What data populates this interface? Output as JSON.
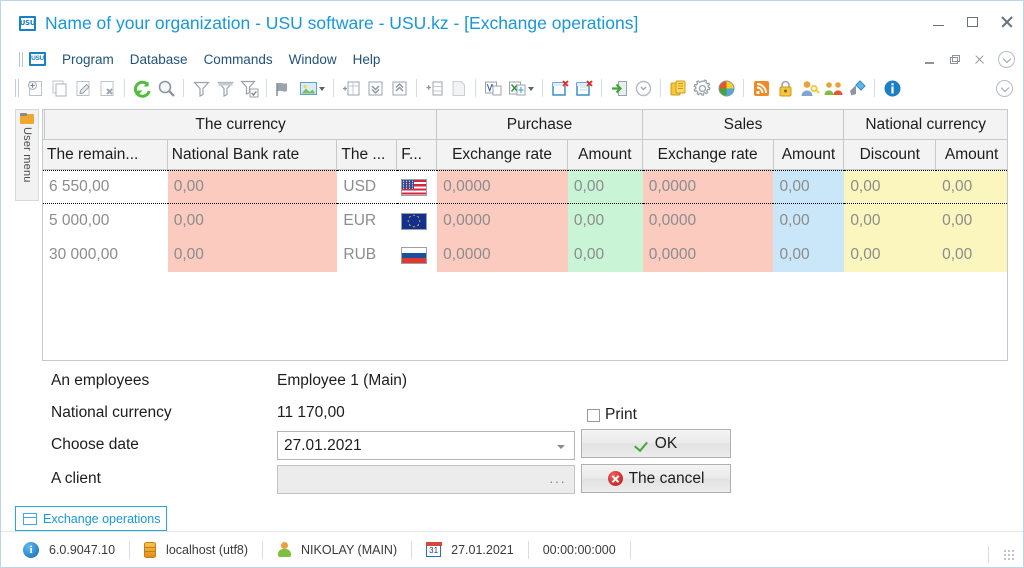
{
  "window": {
    "title": "Name of your organization - USU software - USU.kz - [Exchange operations]",
    "app_icon": "usu",
    "minimize": "–",
    "maximize": "□",
    "close": "×"
  },
  "menubar": {
    "icon": "usu",
    "items": [
      {
        "label": "Program"
      },
      {
        "label": "Database"
      },
      {
        "label": "Commands"
      },
      {
        "label": "Window"
      },
      {
        "label": "Help"
      }
    ]
  },
  "toolbar": {
    "groups": [
      {
        "icons": [
          "add-record-icon",
          "copy-record-icon",
          "edit-record-icon",
          "delete-record-icon"
        ]
      },
      {
        "icons": [
          "refresh-icon",
          "search-icon"
        ]
      },
      {
        "icons": [
          "filter-icon",
          "filter-advanced-icon",
          "filter-apply-icon"
        ]
      },
      {
        "icons": [
          "bookmark-icon",
          "image-view-icon"
        ]
      },
      {
        "icons": [
          "group-columns-icon",
          "expand-all-icon",
          "collapse-all-icon"
        ]
      },
      {
        "icons": [
          "add-column-icon",
          "blank-page-icon"
        ]
      },
      {
        "icons": [
          "export-word-icon",
          "export-excel-icon"
        ]
      },
      {
        "icons": [
          "close-window-icon",
          "close-all-windows-icon"
        ]
      },
      {
        "icons": [
          "exit-icon",
          "history-icon"
        ]
      },
      {
        "icons": [
          "money-icon",
          "settings-icon",
          "palette-icon"
        ]
      },
      {
        "icons": [
          "rss-icon",
          "lock-icon",
          "user-rights-icon",
          "users-group-icon",
          "plugin-icon"
        ]
      },
      {
        "icons": [
          "about-info-icon"
        ]
      }
    ]
  },
  "sidebar": {
    "tab_label": "User menu",
    "icon": "folder-icon"
  },
  "grid": {
    "group_headers": [
      {
        "label": "",
        "span": 0
      },
      {
        "label": "The currency"
      },
      {
        "label": "Purchase"
      },
      {
        "label": "Sales"
      },
      {
        "label": "National currency"
      }
    ],
    "columns": [
      {
        "label": "The remain...",
        "align": "left"
      },
      {
        "label": "National Bank rate",
        "align": "left"
      },
      {
        "label": "The ...",
        "align": "left"
      },
      {
        "label": "F...",
        "align": "left"
      },
      {
        "label": "Exchange rate",
        "align": "center"
      },
      {
        "label": "Amount",
        "align": "center"
      },
      {
        "label": "Exchange rate",
        "align": "center"
      },
      {
        "label": "Amount",
        "align": "center"
      },
      {
        "label": "Discount",
        "align": "center"
      },
      {
        "label": "Amount",
        "align": "center"
      }
    ],
    "rows": [
      {
        "selected": true,
        "remainder": "6 550,00",
        "nb_rate": "0,00",
        "currency": "USD",
        "flag": "flag-usd",
        "purchase_rate": "0,0000",
        "purchase_amount": "0,00",
        "sales_rate": "0,0000",
        "sales_amount": "0,00",
        "discount": "0,00",
        "nat_amount": "0,00"
      },
      {
        "selected": false,
        "remainder": "5 000,00",
        "nb_rate": "0,00",
        "currency": "EUR",
        "flag": "flag-eur",
        "purchase_rate": "0,0000",
        "purchase_amount": "0,00",
        "sales_rate": "0,0000",
        "sales_amount": "0,00",
        "discount": "0,00",
        "nat_amount": "0,00"
      },
      {
        "selected": false,
        "remainder": "30 000,00",
        "nb_rate": "0,00",
        "currency": "RUB",
        "flag": "flag-rub",
        "purchase_rate": "0,0000",
        "purchase_amount": "0,00",
        "sales_rate": "0,0000",
        "sales_amount": "0,00",
        "discount": "0,00",
        "nat_amount": "0,00"
      }
    ],
    "cell_colors": {
      "pink": "#fbcbc0",
      "green": "#c9f5d6",
      "blue": "#cae7fa",
      "yellow": "#fbf6bd",
      "white": "#ffffff"
    }
  },
  "form": {
    "employee_label": "An employees",
    "employee_value": "Employee 1 (Main)",
    "national_currency_label": "National currency",
    "national_currency_value": "11 170,00",
    "date_label": "Choose date",
    "date_value": "27.01.2021",
    "client_label": "A client",
    "client_value": "",
    "client_ellipsis": "···",
    "print_label": "Print",
    "print_checked": false,
    "ok_label": "OK",
    "cancel_label": "The cancel"
  },
  "doctab": {
    "label": "Exchange operations",
    "icon": "window-icon"
  },
  "statusbar": {
    "version": "6.0.9047.10",
    "server": "localhost (utf8)",
    "user": "NIKOLAY (MAIN)",
    "date": "27.01.2021",
    "time": "00:00:00:000",
    "calendar_day": "31"
  },
  "colors": {
    "title_blue": "#1b96d8",
    "menu_blue": "#23527c",
    "accent": "#2ca4e0"
  }
}
